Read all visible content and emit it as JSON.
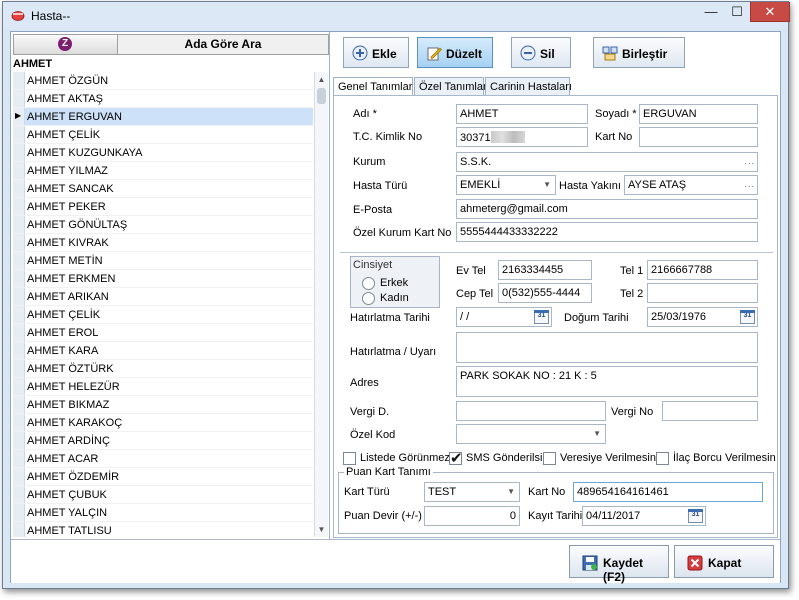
{
  "window": {
    "title": "Hasta--",
    "minimize": "—",
    "maximize": "☐",
    "close": "✕"
  },
  "search": {
    "title": "Ada Göre Ara",
    "filter_text": "AHMET"
  },
  "patients": [
    "AHMET ÖZGÜN",
    "AHMET AKTAŞ",
    "AHMET ERGUVAN",
    "AHMET ÇELİK",
    "AHMET KUZGUNKAYA",
    "AHMET YILMAZ",
    "AHMET SANCAK",
    "AHMET PEKER",
    "AHMET GÖNÜLTAŞ",
    "AHMET KIVRAK",
    "AHMET METİN",
    "AHMET ERKMEN",
    "AHMET ARIKAN",
    "AHMET ÇELİK",
    "AHMET EROL",
    "AHMET KARA",
    "AHMET ÖZTÜRK",
    "AHMET HELEZÜR",
    "AHMET BIKMAZ",
    "AHMET KARAKOÇ",
    "AHMET ARDİNÇ",
    "AHMET ACAR",
    "AHMET ÖZDEMİR",
    "AHMET ÇUBUK",
    "AHMET YALÇIN",
    "AHMET TATLISU"
  ],
  "selected_index": 2,
  "toolbar": {
    "add": "Ekle",
    "edit": "Düzelt",
    "delete": "Sil",
    "merge": "Birleştir"
  },
  "tabs": [
    "Genel Tanımlar",
    "Özel Tanımlar",
    "Carinin Hastaları"
  ],
  "form": {
    "labels": {
      "name": "Adı *",
      "surname": "Soyadı *",
      "tc": "T.C. Kimlik No",
      "card": "Kart No",
      "institution": "Kurum",
      "patient_type": "Hasta Türü",
      "relative": "Hasta Yakını",
      "email": "E-Posta",
      "special_card": "Özel Kurum Kart No",
      "gender": "Cinsiyet",
      "male": "Erkek",
      "female": "Kadın",
      "home_tel": "Ev Tel",
      "tel1": "Tel 1",
      "mobile": "Cep Tel",
      "tel2": "Tel 2",
      "reminder_date": "Hatırlatma Tarihi",
      "birth_date": "Doğum Tarihi",
      "reminder_note": "Hatırlatma / Uyarı",
      "address": "Adres",
      "tax_office": "Vergi D.",
      "tax_no": "Vergi No",
      "special_code": "Özel Kod",
      "hide_list": "Listede Görünmez",
      "sms": "SMS Gönderilsin",
      "no_credit": "Veresiye Verilmesin",
      "no_drug_debt": "İlaç Borcu Verilmesin"
    },
    "values": {
      "name": "AHMET",
      "surname": "ERGUVAN",
      "tc_prefix": "30371",
      "card": "",
      "institution": "S.S.K.",
      "patient_type": "EMEKLİ",
      "relative": "AYSE ATAŞ",
      "email": "ahmeterg@gmail.com",
      "special_card": "5555444433332222",
      "home_tel": "2163334455",
      "tel1": "2166667788",
      "mobile": "0(532)555-4444",
      "tel2": "",
      "reminder_date": " /  /",
      "birth_date": "25/03/1976",
      "reminder_note": "",
      "address": "PARK SOKAK NO : 21 K : 5",
      "tax_office": "",
      "tax_no": "",
      "special_code": "",
      "sms_checked": true
    },
    "calendar_label": "31"
  },
  "points": {
    "title": "Puan Kart Tanımı",
    "card_type_label": "Kart Türü",
    "card_type": "TEST",
    "card_no_label": "Kart No",
    "card_no": "489654164161461",
    "balance_label": "Puan Devir (+/-)",
    "balance": "0",
    "reg_date_label": "Kayıt Tarihi",
    "reg_date": "04/11/2017"
  },
  "footer": {
    "save": "Kaydet (F2)",
    "close": "Kapat"
  }
}
